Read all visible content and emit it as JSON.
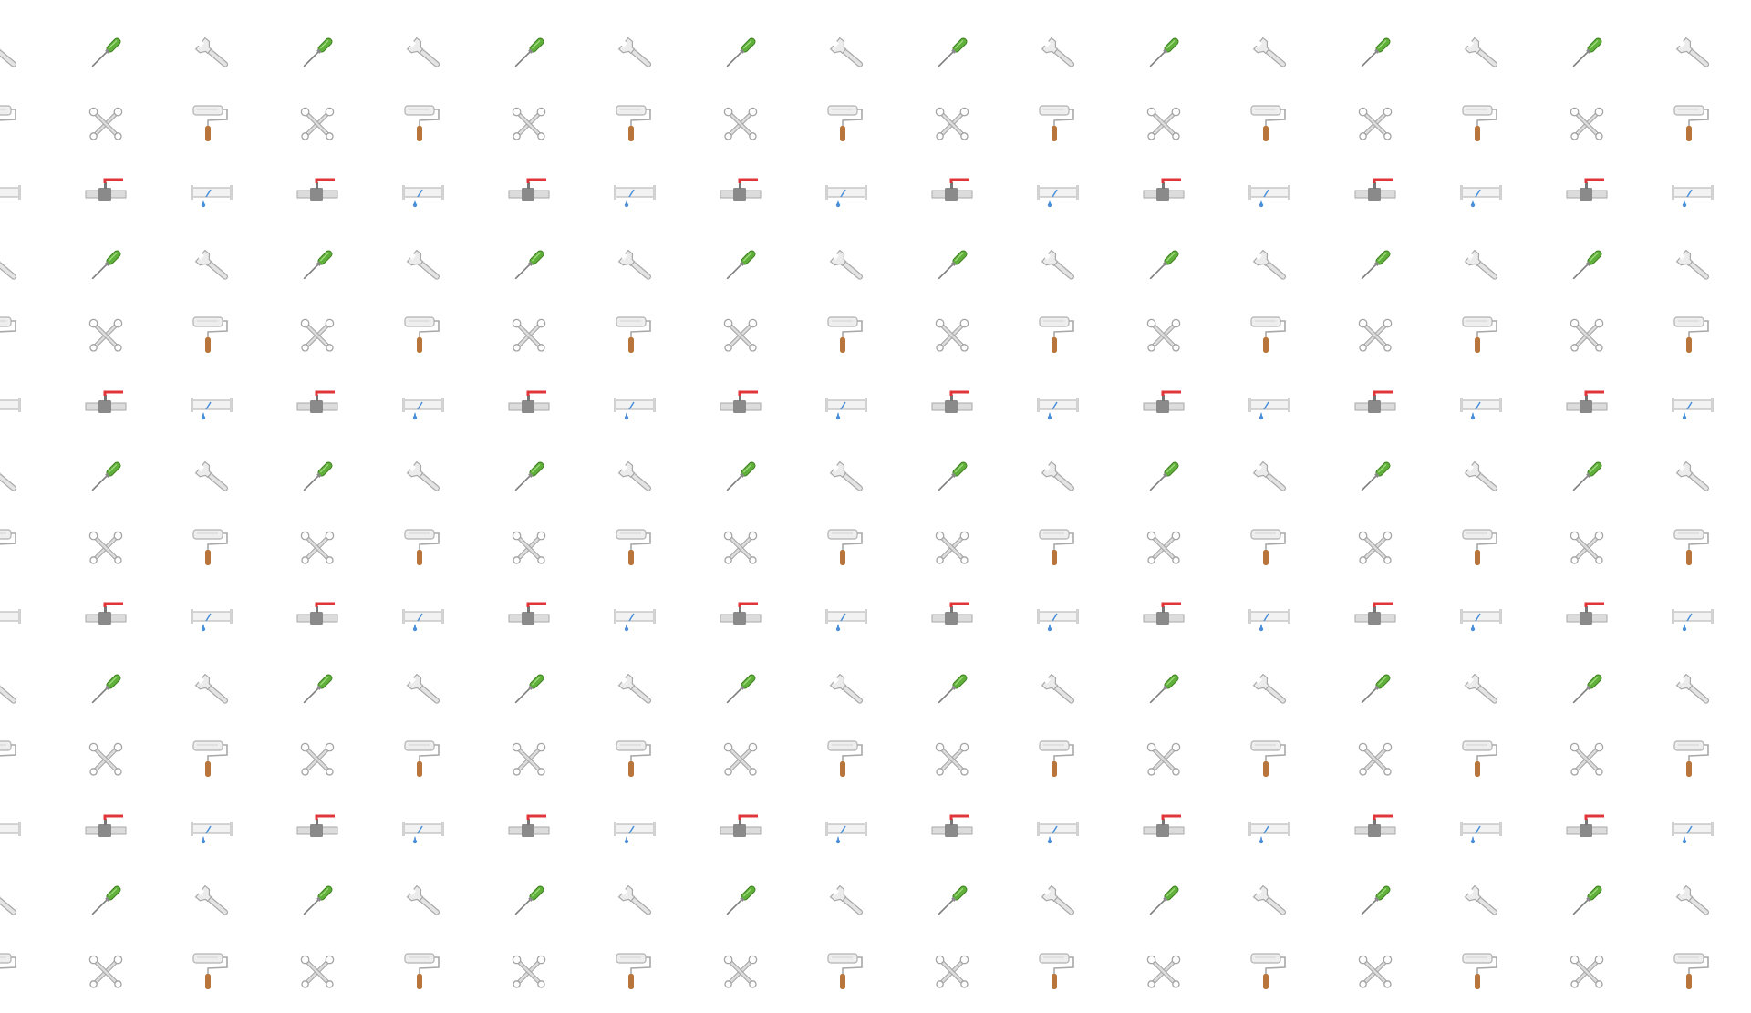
{
  "pattern": {
    "background_color": "#ffffff",
    "icons": [
      {
        "name": "adjustable-wrench-icon",
        "color": "#c8c8c8"
      },
      {
        "name": "screwdriver-icon",
        "color": "#5fb13a"
      },
      {
        "name": "paint-roller-icon",
        "color": "#b8763c"
      },
      {
        "name": "crossed-wrenches-icon",
        "color": "#c4c4c4"
      },
      {
        "name": "leaking-pipe-icon",
        "color": "#4a90d9"
      },
      {
        "name": "pipe-valve-icon",
        "color": "#e0363a"
      }
    ]
  }
}
